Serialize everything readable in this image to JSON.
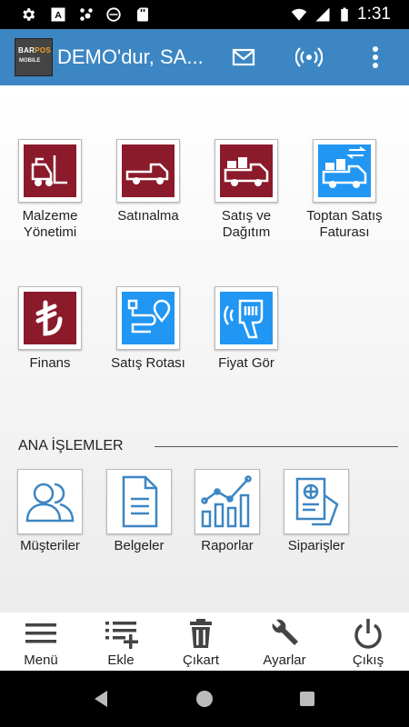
{
  "status_bar": {
    "time": "1:31"
  },
  "app_bar": {
    "logo_line1a": "BAR",
    "logo_line1b": "POS",
    "logo_line2": "MOBILE",
    "title": "DEMO'dur, SA..."
  },
  "modules": [
    {
      "label": "Malzeme Yönetimi",
      "icon": "forklift-icon",
      "color": "#8b1a2b"
    },
    {
      "label": "Satınalma",
      "icon": "pickup-truck-icon",
      "color": "#8b1a2b"
    },
    {
      "label": "Satış ve Dağıtım",
      "icon": "delivery-truck-icon",
      "color": "#8b1a2b"
    },
    {
      "label": "Toptan Satış Faturası",
      "icon": "wholesale-truck-icon",
      "color": "#2196f3"
    },
    {
      "label": "Finans",
      "icon": "lira-icon",
      "color": "#8b1a2b"
    },
    {
      "label": "Satış Rotası",
      "icon": "route-icon",
      "color": "#2196f3"
    },
    {
      "label": "Fiyat Gör",
      "icon": "barcode-scanner-icon",
      "color": "#2196f3"
    }
  ],
  "section": {
    "title": "ANA İŞLEMLER"
  },
  "main_actions": [
    {
      "label": "Müşteriler",
      "icon": "customers-icon"
    },
    {
      "label": "Belgeler",
      "icon": "documents-icon"
    },
    {
      "label": "Raporlar",
      "icon": "reports-icon"
    },
    {
      "label": "Siparişler",
      "icon": "orders-icon"
    }
  ],
  "toolbar": {
    "menu": "Menü",
    "add": "Ekle",
    "remove": "Çıkart",
    "settings": "Ayarlar",
    "exit": "Çıkış"
  },
  "colors": {
    "app_bar": "#3c86c3",
    "maroon": "#8b1a2b",
    "blue": "#2196f3",
    "outline_blue": "#3c86c3"
  }
}
